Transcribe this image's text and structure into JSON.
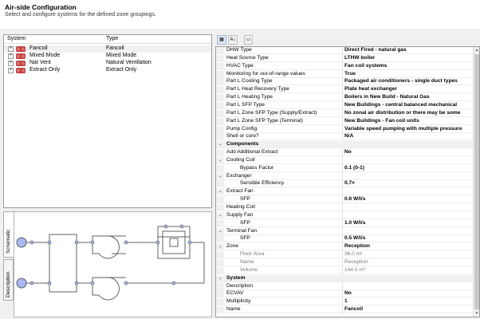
{
  "header": {
    "title": "Air-side Configuration",
    "subtitle": "Select and configure systems for the defined zone groupings."
  },
  "tree": {
    "col_system": "System",
    "col_type": "Type",
    "rows": [
      {
        "name": "Fancoil",
        "type": "Fancoil",
        "expander": "+"
      },
      {
        "name": "Mixed Mode",
        "type": "Mixed Mode",
        "expander": "+"
      },
      {
        "name": "Nat Vent",
        "type": "Natural Ventilation",
        "expander": "+"
      },
      {
        "name": "Extract Only",
        "type": "Extract Only",
        "expander": "+"
      }
    ]
  },
  "tabs": {
    "schematic": "Schematic",
    "description": "Description"
  },
  "toolbar": {
    "categorized_icon": "categorized-view-icon",
    "alpha_icon": "alphabetical-sort-icon",
    "pages_icon": "property-pages-icon",
    "alpha_glyph": "A↓",
    "categorized_glyph": "▦"
  },
  "properties": {
    "rows": [
      {
        "kind": "prop",
        "label": "DHW Type",
        "value": "Direct Fired - natural gas"
      },
      {
        "kind": "prop",
        "label": "Heat Source Type",
        "value": "LTHW boiler"
      },
      {
        "kind": "prop",
        "label": "HVAC Type",
        "value": "Fan coil systems"
      },
      {
        "kind": "prop",
        "label": "Monitoring for out-of-range values",
        "value": "True"
      },
      {
        "kind": "prop",
        "label": "Part L Cooling Type",
        "value": "Packaged air conditioners - single duct types"
      },
      {
        "kind": "prop",
        "label": "Part L Heat Recovery Type",
        "value": "Plate heat exchanger"
      },
      {
        "kind": "prop",
        "label": "Part L Heating Type",
        "value": "Boilers in New Build - Natural Gas"
      },
      {
        "kind": "prop",
        "label": "Part L SFP Type",
        "value": "New Buildings - central balanced mechanical"
      },
      {
        "kind": "prop",
        "label": "Part L Zone SFP Type (Supply/Extract)",
        "value": "No zonal air distribution or there may be some"
      },
      {
        "kind": "prop",
        "label": "Part L Zone SFP Type (Terminal)",
        "value": "New Buildings - Fan coil units"
      },
      {
        "kind": "prop",
        "label": "Pump Config",
        "value": "Variable speed pumping with multiple pressure"
      },
      {
        "kind": "prop",
        "label": "Shell or core?",
        "value": "N/A"
      },
      {
        "kind": "cat",
        "label": "Components",
        "value": ""
      },
      {
        "kind": "prop",
        "label": "Add Additional Extract",
        "value": "No"
      },
      {
        "kind": "group",
        "label": "Cooling Coil",
        "value": ""
      },
      {
        "kind": "child",
        "label": "Bypass Factor",
        "value": "0.1 (0-1)"
      },
      {
        "kind": "group",
        "label": "Exchanger",
        "value": ""
      },
      {
        "kind": "child",
        "label": "Sensible Efficiency",
        "value": "0.7×"
      },
      {
        "kind": "group",
        "label": "Extract Fan",
        "value": ""
      },
      {
        "kind": "child",
        "label": "SFP",
        "value": "0.6 W/l/s"
      },
      {
        "kind": "prop",
        "label": "Heating Coil",
        "value": ""
      },
      {
        "kind": "group",
        "label": "Supply Fan",
        "value": ""
      },
      {
        "kind": "child",
        "label": "SFP",
        "value": "1.0 W/l/s"
      },
      {
        "kind": "group",
        "label": "Terminal Fan",
        "value": ""
      },
      {
        "kind": "child",
        "label": "SFP",
        "value": "0.5 W/l/s"
      },
      {
        "kind": "group",
        "label": "Zone",
        "value": "Reception"
      },
      {
        "kind": "sub",
        "label": "Floor Area",
        "value": "36.0 m²"
      },
      {
        "kind": "sub",
        "label": "Name",
        "value": "Reception"
      },
      {
        "kind": "sub",
        "label": "Volume",
        "value": "144.0 m³"
      },
      {
        "kind": "cat",
        "label": "System",
        "value": ""
      },
      {
        "kind": "prop",
        "label": "Description",
        "value": ""
      },
      {
        "kind": "prop",
        "label": "ECVAV",
        "value": "No"
      },
      {
        "kind": "prop",
        "label": "Multiplicity",
        "value": "1"
      },
      {
        "kind": "prop",
        "label": "Name",
        "value": "Fancoil"
      }
    ]
  },
  "colors": {
    "selection": "#f1f1f1",
    "node_fill": "#a9b8f0",
    "line": "#606060",
    "system_icon": "#c04040"
  }
}
